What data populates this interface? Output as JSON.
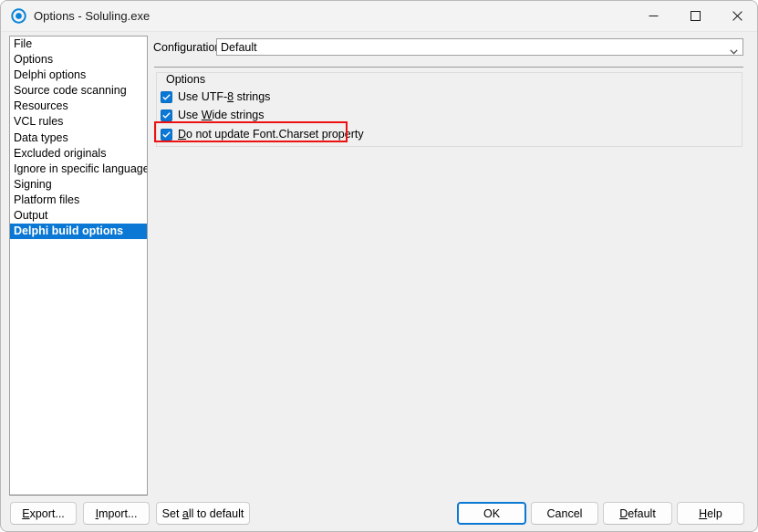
{
  "window": {
    "title": "Options - Soluling.exe",
    "icon": "app-circle-icon",
    "controls": {
      "minimize": "minimize-icon",
      "maximize": "maximize-icon",
      "close": "close-icon"
    }
  },
  "sidebar": {
    "items": [
      {
        "label": "File",
        "selected": false
      },
      {
        "label": "Options",
        "selected": false
      },
      {
        "label": "Delphi options",
        "selected": false
      },
      {
        "label": "Source code scanning",
        "selected": false
      },
      {
        "label": "Resources",
        "selected": false
      },
      {
        "label": "VCL rules",
        "selected": false
      },
      {
        "label": "Data types",
        "selected": false
      },
      {
        "label": "Excluded originals",
        "selected": false
      },
      {
        "label": "Ignore in specific languages",
        "selected": false
      },
      {
        "label": "Signing",
        "selected": false
      },
      {
        "label": "Platform files",
        "selected": false
      },
      {
        "label": "Output",
        "selected": false
      },
      {
        "label": "Delphi build options",
        "selected": true
      }
    ]
  },
  "configuration": {
    "label": "Configuration:",
    "value": "Default",
    "arrow_icon": "chevron-down-icon"
  },
  "options_group": {
    "title": "Options",
    "checkboxes": [
      {
        "pre": "Use UTF-",
        "accel": "8",
        "post": " strings",
        "full_label": "Use UTF-8 strings",
        "checked": true,
        "highlighted": false
      },
      {
        "pre": "Use ",
        "accel": "W",
        "post": "ide strings",
        "full_label": "Use Wide strings",
        "checked": true,
        "highlighted": false
      },
      {
        "pre": "",
        "accel": "D",
        "post": "o not update Font.Charset property",
        "full_label": "Do not update Font.Charset property",
        "checked": true,
        "highlighted": true
      }
    ]
  },
  "footer": {
    "left_buttons": [
      {
        "pre": "",
        "accel": "E",
        "post": "xport...",
        "full_label": "Export..."
      },
      {
        "pre": "",
        "accel": "I",
        "post": "mport...",
        "full_label": "Import..."
      },
      {
        "pre": "Set ",
        "accel": "a",
        "post": "ll to default",
        "full_label": "Set all to default"
      }
    ],
    "right_buttons": [
      {
        "pre": "OK",
        "accel": "",
        "post": "",
        "full_label": "OK",
        "is_default": true
      },
      {
        "pre": "Cancel",
        "accel": "",
        "post": "",
        "full_label": "Cancel",
        "is_default": false
      },
      {
        "pre": "",
        "accel": "D",
        "post": "efault",
        "full_label": "Default",
        "is_default": false
      },
      {
        "pre": "",
        "accel": "H",
        "post": "elp",
        "full_label": "Help",
        "is_default": false
      }
    ]
  },
  "annotation": {
    "type": "highlight-rectangle",
    "color": "#ee1111",
    "target": "Do not update Font.Charset property"
  },
  "colors": {
    "accent": "#0a78d4",
    "selection": "#0a78d4",
    "window_bg": "#f0f0f0",
    "titlebar_bg": "#f3f3f3",
    "highlight": "#ee1111"
  }
}
